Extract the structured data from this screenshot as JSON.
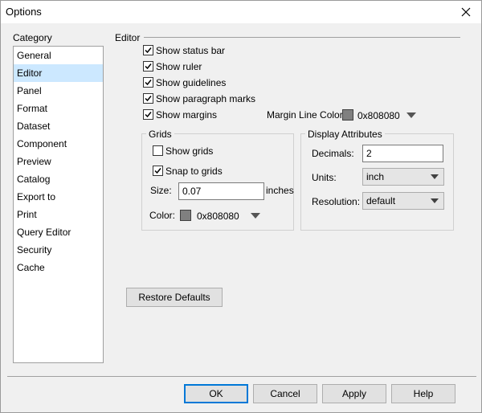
{
  "window": {
    "title": "Options"
  },
  "category": {
    "label": "Category",
    "items": [
      "General",
      "Editor",
      "Panel",
      "Format",
      "Dataset",
      "Component",
      "Preview",
      "Catalog",
      "Export to",
      "Print",
      "Query Editor",
      "Security",
      "Cache"
    ],
    "selected": "Editor"
  },
  "editor": {
    "section_label": "Editor",
    "show_status_bar": {
      "label": "Show status bar",
      "checked": true
    },
    "show_ruler": {
      "label": "Show ruler",
      "checked": true
    },
    "show_guidelines": {
      "label": "Show guidelines",
      "checked": true
    },
    "show_paragraph_marks": {
      "label": "Show paragraph marks",
      "checked": true
    },
    "show_margins": {
      "label": "Show margins",
      "checked": true
    },
    "margin_line_color": {
      "label": "Margin Line Color:",
      "value": "0x808080",
      "swatch": "#808080"
    }
  },
  "grids": {
    "title": "Grids",
    "show_grids": {
      "label": "Show grids",
      "checked": false
    },
    "snap_to_grids": {
      "label": "Snap to grids",
      "checked": true
    },
    "size": {
      "label": "Size:",
      "value": "0.07",
      "unit": "inches"
    },
    "color": {
      "label": "Color:",
      "value": "0x808080",
      "swatch": "#808080"
    }
  },
  "display_attributes": {
    "title": "Display Attributes",
    "decimals": {
      "label": "Decimals:",
      "value": "2"
    },
    "units": {
      "label": "Units:",
      "value": "inch"
    },
    "resolution": {
      "label": "Resolution:",
      "value": "default"
    }
  },
  "buttons": {
    "restore_defaults": "Restore Defaults",
    "ok": "OK",
    "cancel": "Cancel",
    "apply": "Apply",
    "help": "Help"
  }
}
